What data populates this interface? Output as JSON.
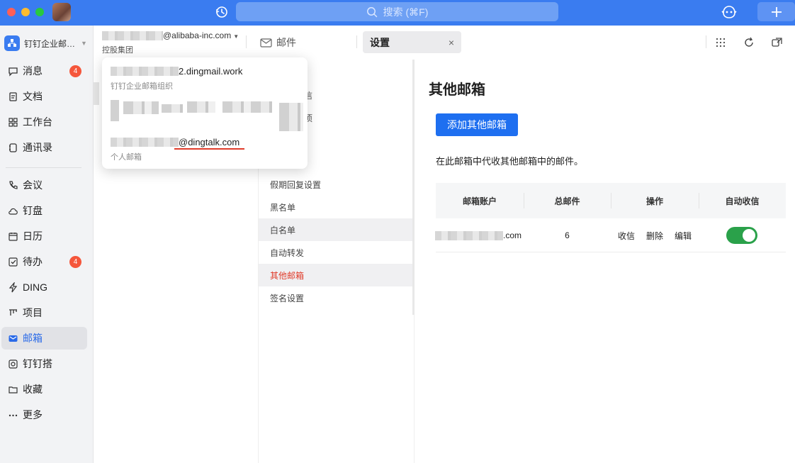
{
  "titlebar": {
    "search_placeholder": "搜索 (⌘F)"
  },
  "sidebar": {
    "org_name": "钉钉企业邮…",
    "items": [
      {
        "label": "消息",
        "icon": "chat-bubble-icon",
        "badge": "4"
      },
      {
        "label": "文档",
        "icon": "document-icon"
      },
      {
        "label": "工作台",
        "icon": "grid-icon"
      },
      {
        "label": "通讯录",
        "icon": "contacts-icon"
      },
      {
        "label": "会议",
        "icon": "phone-icon"
      },
      {
        "label": "钉盘",
        "icon": "cloud-drive-icon"
      },
      {
        "label": "日历",
        "icon": "calendar-icon"
      },
      {
        "label": "待办",
        "icon": "checkbox-icon",
        "badge": "4"
      },
      {
        "label": "DING",
        "icon": "lightning-icon"
      },
      {
        "label": "项目",
        "icon": "project-icon"
      },
      {
        "label": "邮箱",
        "icon": "mail-icon",
        "active": true
      },
      {
        "label": "钉钉搭",
        "icon": "builder-icon"
      },
      {
        "label": "收藏",
        "icon": "folder-icon"
      },
      {
        "label": "更多",
        "icon": "more-icon"
      }
    ],
    "accent": "#2a6ae8"
  },
  "header": {
    "account_suffix": "@alibaba-inc.com",
    "org_label": "控股集团",
    "tabs": [
      {
        "label": "邮件"
      },
      {
        "label": "设置",
        "close": "×"
      }
    ]
  },
  "dropdown": {
    "accounts": [
      {
        "address_suffix": "2.dingmail.work",
        "sub": "钉钉企业邮箱组织"
      },
      {
        "address_suffix": "@dingtalk.com",
        "sub": "个人邮箱"
      }
    ]
  },
  "settings_menu": {
    "peek_1": "信",
    "peek_2": "项",
    "items": [
      "假期回复设置",
      "黑名单",
      "白名单",
      "自动转发",
      "其他邮箱",
      "签名设置"
    ],
    "active": "其他邮箱"
  },
  "content": {
    "title": "其他邮箱",
    "add_button": "添加其他邮箱",
    "description": "在此邮箱中代收其他邮箱中的邮件。",
    "table": {
      "headers": [
        "邮箱账户",
        "总邮件",
        "操作",
        "自动收信"
      ],
      "rows": [
        {
          "account_suffix": ".com",
          "total": "6",
          "ops": [
            "收信",
            "删除",
            "编辑"
          ],
          "auto_receive": true
        }
      ]
    }
  },
  "colors": {
    "titlebar": "#3a7cf0",
    "primary_button": "#1e6ff0",
    "active_menu_text": "#e03b2a",
    "toggle_on": "#2aa14a",
    "badge": "#f5563b"
  }
}
